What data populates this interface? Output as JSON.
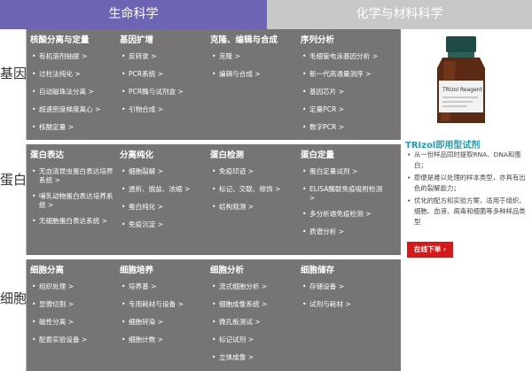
{
  "tabs": {
    "life": "生命科学",
    "chem": "化学与材料科学"
  },
  "sections": {
    "gene": {
      "label": "基因",
      "cols": [
        {
          "title": "核酸分离与定量",
          "items": [
            "有机溶剂抽提 >",
            "过柱法纯化 >",
            "自动磁珠法分离 >",
            "超速密度梯度离心 >",
            "核酸定量 >"
          ]
        },
        {
          "title": "基因扩增",
          "items": [
            "反转录 >",
            "PCR系统 >",
            "PCR酶与试剂盒 >",
            "引物合成 >"
          ]
        },
        {
          "title": "克隆、编辑与合成",
          "items": [
            "克隆 >",
            "编辑与合成 >"
          ]
        },
        {
          "title": "序列分析",
          "items": [
            "毛细管电泳基因分析 >",
            "新一代高通量测序 >",
            "基因芯片 >",
            "定量PCR >",
            "数字PCR >"
          ]
        }
      ]
    },
    "protein": {
      "label": "蛋白",
      "cols": [
        {
          "title": "蛋白表达",
          "items": [
            "无血清昆虫蛋白表达培养系统 >",
            "哺乳动物蛋白表达培养系统 >",
            "无细胞蛋白表达系统 >"
          ]
        },
        {
          "title": "分离纯化",
          "items": [
            "细胞裂解 >",
            "透析、脱盐、浓缩 >",
            "蛋白纯化 >",
            "免疫沉淀 >"
          ]
        },
        {
          "title": "蛋白检测",
          "items": [
            "免疫印迹 >",
            "标记、交联、修饰 >",
            "结构观测 >"
          ]
        },
        {
          "title": "蛋白定量",
          "items": [
            "蛋白定量试剂 >",
            "ELISA酶联免疫吸附检测 >",
            "多分析通免疫检测 >",
            "质谱分析 >"
          ]
        }
      ]
    },
    "cell": {
      "label": "细胞",
      "cols": [
        {
          "title": "细胞分离",
          "items": [
            "组织处理 >",
            "显微切割 >",
            "磁性分离 >",
            "配套实验设备 >"
          ]
        },
        {
          "title": "细胞培养",
          "items": [
            "培养基 >",
            "专用耗材与设备 >",
            "细胞转染 >",
            "细胞计数 >"
          ]
        },
        {
          "title": "细胞分析",
          "items": [
            "流式细胞分析 >",
            "细胞成像系统 >",
            "微孔板测试 >",
            "标记试剂 >",
            "立体成像 >"
          ]
        },
        {
          "title": "细胞储存",
          "items": [
            "存储设备 >",
            "试剂与耗材 >"
          ]
        }
      ]
    }
  },
  "ad": {
    "title": "TRIzol即用型试剂",
    "bullets": [
      "从一份样品同时提取RNA、DNA和蛋白；",
      "即便是难以处理的样本类型，亦具有出色的裂解能力；",
      "优化的配方和实验方案，适用于组织、细胞、血液、病毒和细菌等多种样品类型"
    ],
    "button": "在线下单 ›",
    "bottle_label": "TRIzol Reagent"
  }
}
